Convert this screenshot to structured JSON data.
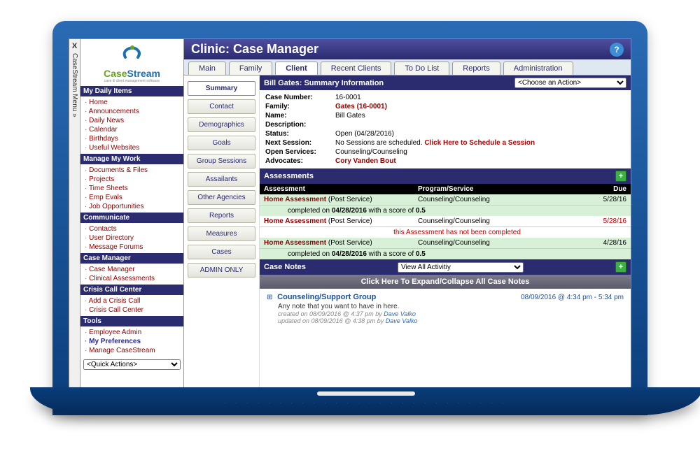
{
  "vertMenu": {
    "close": "X",
    "label": "CaseStream Menu »"
  },
  "logo": {
    "part1": "Case",
    "part2": "Stream",
    "tagline": "case & client management software"
  },
  "sidebar": [
    {
      "hdr": "My Daily Items",
      "items": [
        "Home",
        "Announcements",
        "Daily News",
        "Calendar",
        "Birthdays",
        "Useful Websites"
      ]
    },
    {
      "hdr": "Manage My Work",
      "items": [
        "Documents & Files",
        "Projects",
        "Time Sheets",
        "Emp Evals",
        "Job Opportunities"
      ]
    },
    {
      "hdr": "Communicate",
      "items": [
        "Contacts",
        "User Directory",
        "Message Forums"
      ]
    },
    {
      "hdr": "Case Manager",
      "items": [
        "Case Manager",
        "Clinical Assessments"
      ]
    },
    {
      "hdr": "Crisis Call Center",
      "items": [
        "Add a Crisis Call",
        "Crisis Call Center"
      ]
    },
    {
      "hdr": "Tools",
      "items": [
        "Employee Admin",
        "My Preferences",
        "Manage CaseStream"
      ],
      "emph": [
        1
      ]
    }
  ],
  "quickActions": {
    "placeholder": "<Quick Actions>"
  },
  "page": {
    "title": "Clinic: Case Manager"
  },
  "tabs": [
    "Main",
    "Family",
    "Client",
    "Recent Clients",
    "To Do List",
    "Reports",
    "Administration"
  ],
  "activeTab": 2,
  "subnav": [
    "Summary",
    "Contact",
    "Demographics",
    "Goals",
    "Group Sessions",
    "Assailants",
    "Other Agencies",
    "Reports",
    "Measures",
    "Cases",
    "ADMIN ONLY"
  ],
  "activeSubnav": 0,
  "summaryHeader": "Bill Gates: Summary Information",
  "actionDropdown": "<Choose an Action>",
  "info": {
    "caseNumber": {
      "lbl": "Case Number:",
      "val": "16-0001"
    },
    "family": {
      "lbl": "Family:",
      "val": "Gates (16-0001)"
    },
    "name": {
      "lbl": "Name:",
      "val": "Bill Gates"
    },
    "description": {
      "lbl": "Description:",
      "val": ""
    },
    "status": {
      "lbl": "Status:",
      "val": "Open (04/28/2016)"
    },
    "nextSession": {
      "lbl": "Next Session:",
      "val": "No Sessions are scheduled.",
      "link": "Click Here to Schedule a Session"
    },
    "openServices": {
      "lbl": "Open Services:",
      "val": "Counseling/Counseling"
    },
    "advocates": {
      "lbl": "Advocates:",
      "val": "Cory Vanden Bout"
    }
  },
  "assessments": {
    "title": "Assessments",
    "cols": {
      "c1": "Assessment",
      "c2": "Program/Service",
      "c3": "Due"
    },
    "rows": [
      {
        "name": "Home Assessment",
        "suffix": "(Post Service)",
        "svc": "Counseling/Counseling",
        "due": "5/28/16",
        "done": true,
        "sub": "completed on 04/28/2016 with a score of 0.5",
        "b1": "04/28/2016",
        "b2": "0.5"
      },
      {
        "name": "Home Assessment",
        "suffix": "(Post Service)",
        "svc": "Counseling/Counseling",
        "due": "5/28/16",
        "done": false,
        "sub": "this Assessment has not been completed"
      },
      {
        "name": "Home Assessment",
        "suffix": "(Post Service)",
        "svc": "Counseling/Counseling",
        "due": "4/28/16",
        "done": true,
        "sub": "completed on 04/28/2016 with a score of 0.5",
        "b1": "04/28/2016",
        "b2": "0.5"
      }
    ]
  },
  "caseNotes": {
    "title": "Case Notes",
    "filter": "View All Activitiy",
    "expandAll": "Click Here To Expand/Collapse All Case Notes",
    "items": [
      {
        "title": "Counseling/Support Group",
        "time": "08/09/2016 @ 4:34 pm - 5:34 pm",
        "body": "Any note that you want to have in here.",
        "created": "created on 08/09/2016 @ 4:37 pm by",
        "updated": "updated on 08/09/2016 @ 4:38 pm by",
        "author": "Dave Valko"
      }
    ]
  }
}
